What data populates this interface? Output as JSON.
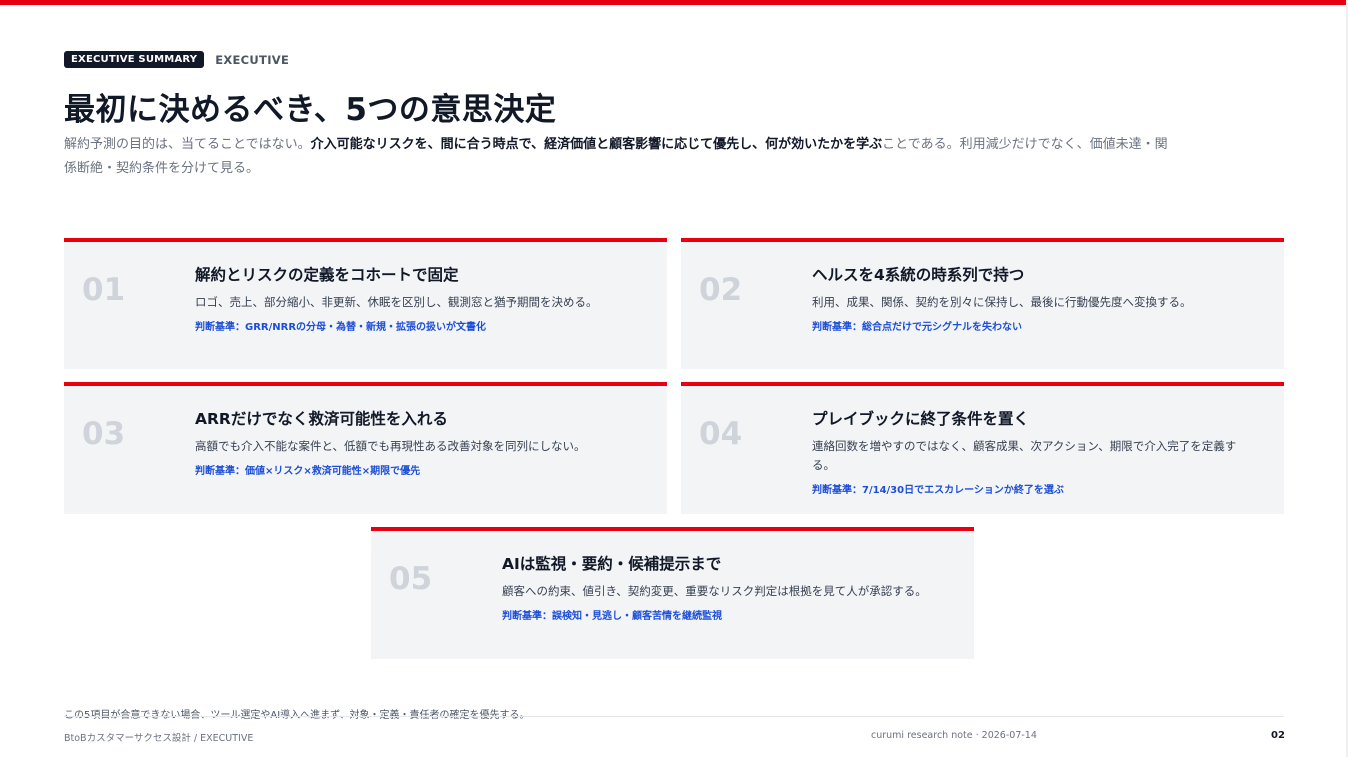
{
  "header": {
    "badge": "EXECUTIVE SUMMARY",
    "section": "EXECUTIVE",
    "title": "最初に決めるべき、5つの意思決定",
    "lead_part1": "解約予測の目的は、当てることではない。",
    "lead_bold": "介入可能なリスクを、間に合う時点で、経済価値と顧客影響に応じて優先し、何が効いたかを学ぶ",
    "lead_part2": "ことである。利用減少だけでなく、価値未達・関係断絶・契約条件を分けて見る。"
  },
  "cards": [
    {
      "number": "01",
      "title": "解約とリスクの定義をコホートで固定",
      "description": "ロゴ、売上、部分縮小、非更新、休眠を区別し、観測窓と猶予期間を決める。",
      "criterion": "判断基準：GRR/NRRの分母・為替・新規・拡張の扱いが文書化"
    },
    {
      "number": "02",
      "title": "ヘルスを4系統の時系列で持つ",
      "description": "利用、成果、関係、契約を別々に保持し、最後に行動優先度へ変換する。",
      "criterion": "判断基準：総合点だけで元シグナルを失わない"
    },
    {
      "number": "03",
      "title": "ARRだけでなく救済可能性を入れる",
      "description": "高額でも介入不能な案件と、低額でも再現性ある改善対象を同列にしない。",
      "criterion": "判断基準：価値×リスク×救済可能性×期限で優先"
    },
    {
      "number": "04",
      "title": "プレイブックに終了条件を置く",
      "description": "連絡回数を増やすのではなく、顧客成果、次アクション、期限で介入完了を定義する。",
      "criterion": "判断基準：7/14/30日でエスカレーションか終了を選ぶ"
    },
    {
      "number": "05",
      "title": "AIは監視・要約・候補提示まで",
      "description": "顧客への約束、値引き、契約変更、重要なリスク判定は根拠を見て人が承認する。",
      "criterion": "判断基準：誤検知・見逃し・顧客苦情を継続監視"
    }
  ],
  "footnote": "この5項目が合意できない場合、ツール選定やAI導入へ進まず、対象・定義・責任者の確定を優先する。",
  "footer": {
    "left": "BtoBカスタマーサクセス設計 / EXECUTIVE",
    "center": "curumi research note · 2026-07-14",
    "page": "02"
  },
  "colors": {
    "accent": "#e60012",
    "criterion": "#1d4ed8",
    "card_bg": "#f3f4f6"
  }
}
